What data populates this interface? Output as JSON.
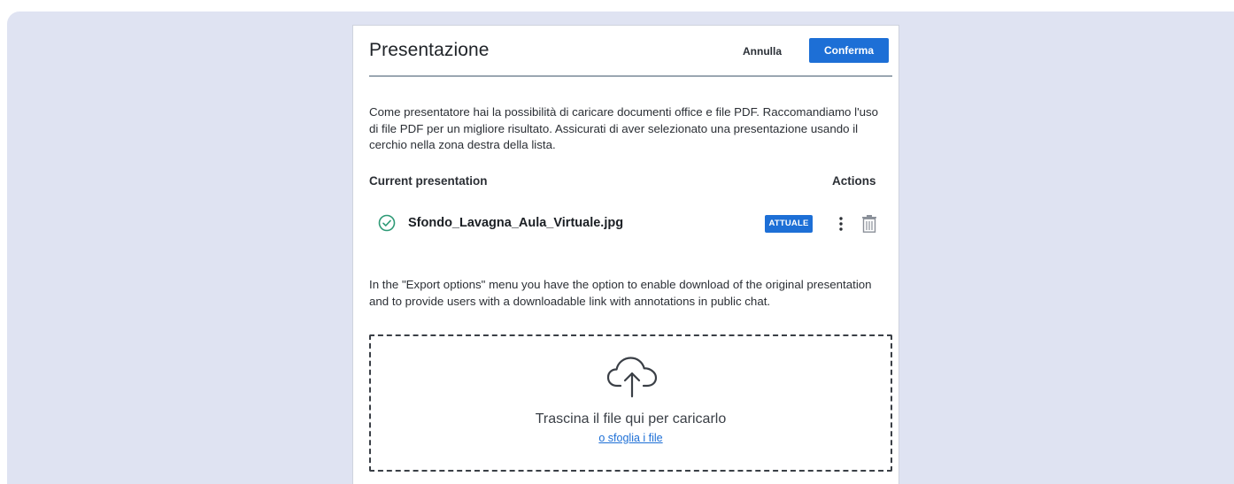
{
  "modal": {
    "title": "Presentazione",
    "cancel_label": "Annulla",
    "confirm_label": "Conferma",
    "intro_text": "Come presentatore hai la possibilità di caricare documenti office e file PDF. Raccomandiamo l'uso di file PDF per un migliore risultato. Assicurati di aver selezionato una presentazione usando il cerchio nella zona destra della lista."
  },
  "table": {
    "col_current": "Current presentation",
    "col_actions": "Actions",
    "rows": [
      {
        "filename": "Sfondo_Lavagna_Aula_Virtuale.jpg",
        "badge": "ATTUALE",
        "selected": true
      }
    ]
  },
  "export_note": "In the \"Export options\" menu you have the option to enable download of the original presentation and to provide users with a downloadable link with annotations in public chat.",
  "dropzone": {
    "text": "Trascina il file qui per caricarlo",
    "browse_link": "o sfoglia i file"
  },
  "icons": {
    "check": "check-circle-icon",
    "more": "kebab-menu-icon",
    "trash": "trash-icon",
    "upload": "cloud-upload-icon"
  },
  "colors": {
    "accent": "#1d6fd6",
    "backdrop": "#dfe3f2",
    "success": "#2e9a76"
  }
}
